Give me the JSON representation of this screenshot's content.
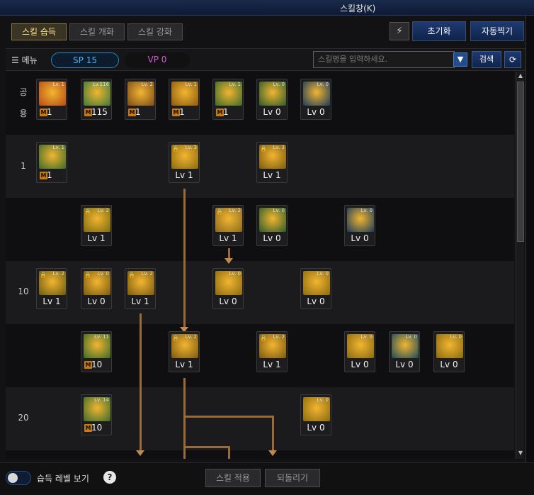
{
  "window": {
    "title": "스킬창(K)"
  },
  "tabs": [
    {
      "label": "스킬 습득",
      "active": true
    },
    {
      "label": "스킬 개화",
      "active": false
    },
    {
      "label": "스킬 강화",
      "active": false
    }
  ],
  "top_buttons": {
    "reset": "초기화",
    "auto": "자동찍기"
  },
  "toolbar": {
    "menu_label": "메뉴",
    "sp_label": "SP 15",
    "vp_label": "VP 0",
    "search_placeholder": "스킬명을 입력하세요.",
    "search_button": "검색"
  },
  "row_labels": {
    "common_1": "공",
    "common_2": "용",
    "lvl1": "1",
    "lvl10": "10",
    "lvl20": "20"
  },
  "skills": [
    {
      "id": "s1",
      "lv": "1",
      "m": true,
      "color": "#b84a14",
      "tag": "Lv. 1"
    },
    {
      "id": "s2",
      "lv": "115",
      "m": true,
      "color": "#3a7a3a",
      "tag": "Lv.116"
    },
    {
      "id": "s3",
      "lv": "1",
      "m": true,
      "color": "#7a4a1a",
      "tag": "Lv. 2"
    },
    {
      "id": "s4",
      "lv": "1",
      "m": true,
      "color": "#8a5a10",
      "tag": "Lv. 1"
    },
    {
      "id": "s5",
      "lv": "1",
      "m": true,
      "color": "#3a6a2a",
      "tag": "Lv. 1"
    },
    {
      "id": "s6",
      "lv": "Lv 0",
      "m": false,
      "color": "#2a5a2a",
      "tag": "Lv. 0"
    },
    {
      "id": "s7",
      "lv": "Lv 0",
      "m": false,
      "color": "#1a3a5a",
      "tag": "Lv. 0"
    },
    {
      "id": "s8",
      "lv": "1",
      "m": true,
      "color": "#3a6a2a",
      "tag": "Lv. 1"
    },
    {
      "id": "s9",
      "lv": "Lv 1",
      "m": false,
      "color": "#8a6a10",
      "tag": "Lv. 3"
    },
    {
      "id": "s10",
      "lv": "Lv 1",
      "m": false,
      "color": "#7a5a10",
      "tag": "Lv. 3"
    },
    {
      "id": "s11",
      "lv": "Lv 1",
      "m": false,
      "color": "#7a6a10",
      "tag": "Lv. 2"
    },
    {
      "id": "s12",
      "lv": "Lv 1",
      "m": false,
      "color": "#8a6a20",
      "tag": "Lv. 2"
    },
    {
      "id": "s13",
      "lv": "Lv 0",
      "m": false,
      "color": "#2a5a2a",
      "tag": "Lv. 0"
    },
    {
      "id": "s14",
      "lv": "Lv 0",
      "m": false,
      "color": "#1a3a5a",
      "tag": "Lv. 0"
    },
    {
      "id": "s15",
      "lv": "Lv 1",
      "m": false,
      "color": "#6a5a10",
      "tag": "Lv. 2"
    },
    {
      "id": "s16",
      "lv": "Lv 0",
      "m": false,
      "color": "#7a5a10",
      "tag": "Lv. 0"
    },
    {
      "id": "s17",
      "lv": "Lv 1",
      "m": false,
      "color": "#7a5a10",
      "tag": "Lv. 2"
    },
    {
      "id": "s18",
      "lv": "Lv 0",
      "m": false,
      "color": "#8a6a10",
      "tag": "Lv. 0"
    },
    {
      "id": "s19",
      "lv": "Lv 0",
      "m": false,
      "color": "#8a6a10",
      "tag": "Lv. 0"
    },
    {
      "id": "s20",
      "lv": "10",
      "m": true,
      "color": "#3a6a2a",
      "tag": "Lv. 11"
    },
    {
      "id": "s21",
      "lv": "Lv 1",
      "m": false,
      "color": "#7a5a10",
      "tag": "Lv. 2"
    },
    {
      "id": "s22",
      "lv": "Lv 1",
      "m": false,
      "color": "#7a5a10",
      "tag": "Lv. 2"
    },
    {
      "id": "s23",
      "lv": "Lv 0",
      "m": false,
      "color": "#8a6a10",
      "tag": "Lv. 0"
    },
    {
      "id": "s24",
      "lv": "Lv 0",
      "m": false,
      "color": "#1a4a5a",
      "tag": "Lv. 0"
    },
    {
      "id": "s25",
      "lv": "Lv 0",
      "m": false,
      "color": "#8a6a10",
      "tag": "Lv. 0"
    },
    {
      "id": "s26",
      "lv": "10",
      "m": true,
      "color": "#3a6a2a",
      "tag": "Lv. 14"
    },
    {
      "id": "s27",
      "lv": "Lv 0",
      "m": false,
      "color": "#8a6a10",
      "tag": "Lv. 0"
    }
  ],
  "m_badge": "M",
  "footer": {
    "toggle_label": "습득 레벨 보기",
    "help": "?",
    "apply": "스킬 적용",
    "revert": "되돌리기"
  },
  "icons": {
    "menu": "menu-icon",
    "refresh": "refresh-icon",
    "dropdown": "dropdown-arrow-icon",
    "filter": "skill-filter-icon"
  }
}
